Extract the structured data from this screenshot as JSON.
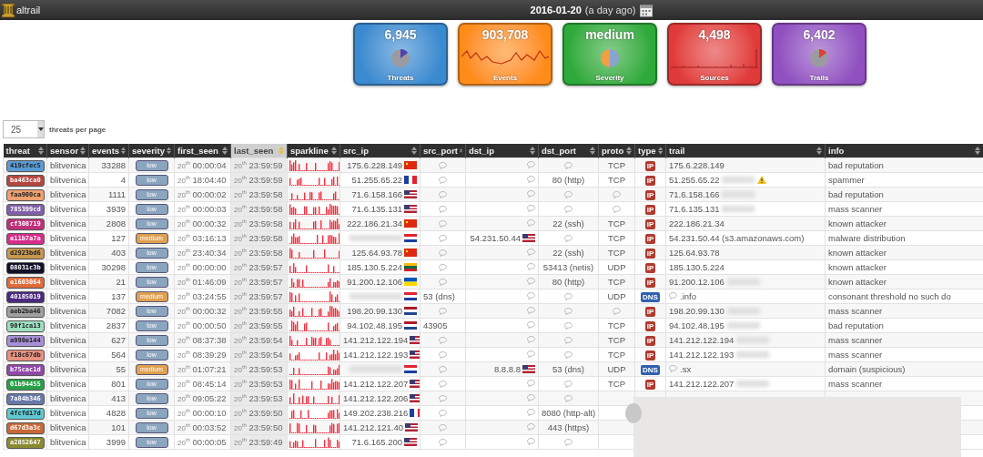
{
  "header": {
    "logo_text": "altrail",
    "date": "2016-01-20",
    "date_note": "(a day ago)"
  },
  "cards": [
    {
      "value": "6,945",
      "label": "Threats",
      "color": "#3a8ad0",
      "kind": "pie"
    },
    {
      "value": "903,708",
      "label": "Events",
      "color": "#ff8c1a",
      "kind": "line"
    },
    {
      "value": "medium",
      "label": "Severity",
      "color": "#2eaa3a",
      "kind": "pie"
    },
    {
      "value": "4,498",
      "label": "Sources",
      "color": "#e03a3a",
      "kind": "bars"
    },
    {
      "value": "6,402",
      "label": "Trails",
      "color": "#9050c0",
      "kind": "pie"
    }
  ],
  "page_size": {
    "value": "25",
    "label": "threats per page"
  },
  "columns": [
    {
      "label": "threat",
      "sorted": false
    },
    {
      "label": "sensor",
      "sorted": false
    },
    {
      "label": "events",
      "sorted": false
    },
    {
      "label": "severity",
      "sorted": false
    },
    {
      "label": "first_seen",
      "sorted": false
    },
    {
      "label": "last_seen",
      "sorted": true
    },
    {
      "label": "sparkline",
      "sorted": false
    },
    {
      "label": "src_ip",
      "sorted": false
    },
    {
      "label": "src_port",
      "sorted": false
    },
    {
      "label": "dst_ip",
      "sorted": false
    },
    {
      "label": "dst_port",
      "sorted": false
    },
    {
      "label": "proto",
      "sorted": false
    },
    {
      "label": "type",
      "sorted": false
    },
    {
      "label": "trail",
      "sorted": false
    },
    {
      "label": "info",
      "sorted": false
    }
  ],
  "rows": [
    {
      "threat": {
        "text": "419cfec5",
        "color": "#5b9bd5"
      },
      "sensor": "blitvenica",
      "events": "33288",
      "severity": {
        "text": "low",
        "color": "#8ba5bf"
      },
      "first_day": "20$^{th}$",
      "first_seen": "00:00:04",
      "last_day": "20$^{th}$",
      "last_seen": "23:59:59",
      "src_ip": "175.6.228.149",
      "src_flag": {
        "kind": "cn"
      },
      "src_port": null,
      "dst_ip": null,
      "dst_port": null,
      "proto": "TCP",
      "type": {
        "text": "IP",
        "color": "#b03a2e"
      },
      "trail": "175.6.228.149",
      "trail_note": false,
      "warning": false,
      "info": "bad reputation"
    },
    {
      "threat": {
        "text": "ba463ca0",
        "color": "#b5463e"
      },
      "sensor": "blitvenica",
      "events": "4",
      "severity": {
        "text": "low",
        "color": "#8ba5bf"
      },
      "first_day": "20$^{th}$",
      "first_seen": "18:04:40",
      "last_day": "20$^{th}$",
      "last_seen": "23:59:59",
      "src_ip": "51.255.65.22",
      "src_flag": {
        "kind": "fr"
      },
      "src_port": null,
      "dst_ip": null,
      "dst_port": "80 (http)",
      "proto": "TCP",
      "type": {
        "text": "IP",
        "color": "#b03a2e"
      },
      "trail": "51.255.65.22",
      "trail_note": true,
      "warning": true,
      "info": "spammer"
    },
    {
      "threat": {
        "text": "faa900ca",
        "color": "#f0a070"
      },
      "sensor": "blitvenica",
      "events": "1111",
      "severity": {
        "text": "low",
        "color": "#8ba5bf"
      },
      "first_day": "20$^{th}$",
      "first_seen": "00:00:02",
      "last_day": "20$^{th}$",
      "last_seen": "23:59:58",
      "src_ip": "71.6.158.166",
      "src_flag": {
        "kind": "us"
      },
      "src_port": null,
      "dst_ip": null,
      "dst_port": null,
      "proto": null,
      "type": {
        "text": "IP",
        "color": "#b03a2e"
      },
      "trail": "71.6.158.166",
      "trail_note": true,
      "warning": false,
      "info": "bad reputation"
    },
    {
      "threat": {
        "text": "785399cd",
        "color": "#8060a8"
      },
      "sensor": "blitvenica",
      "events": "3939",
      "severity": {
        "text": "low",
        "color": "#8ba5bf"
      },
      "first_day": "20$^{th}$",
      "first_seen": "00:00:03",
      "last_day": "20$^{th}$",
      "last_seen": "23:59:58",
      "src_ip": "71.6.135.131",
      "src_flag": {
        "kind": "us"
      },
      "src_port": null,
      "dst_ip": null,
      "dst_port": null,
      "proto": null,
      "type": {
        "text": "IP",
        "color": "#b03a2e"
      },
      "trail": "71.6.135.131",
      "trail_note": true,
      "warning": false,
      "info": "mass scanner"
    },
    {
      "threat": {
        "text": "cf308719",
        "color": "#c0307a"
      },
      "sensor": "blitvenica",
      "events": "2808",
      "severity": {
        "text": "low",
        "color": "#8ba5bf"
      },
      "first_day": "20$^{th}$",
      "first_seen": "00:00:32",
      "last_day": "20$^{th}$",
      "last_seen": "23:59:58",
      "src_ip": "222.186.21.34",
      "src_flag": {
        "kind": "cn"
      },
      "src_port": null,
      "dst_ip": null,
      "dst_port": "22 (ssh)",
      "proto": "TCP",
      "type": {
        "text": "IP",
        "color": "#b03a2e"
      },
      "trail": "222.186.21.34",
      "trail_note": false,
      "warning": false,
      "info": "known attacker"
    },
    {
      "threat": {
        "text": "e11b7a7a",
        "color": "#d82c8a"
      },
      "sensor": "blitvenica",
      "events": "127",
      "severity": {
        "text": "medium",
        "color": "#e0a050"
      },
      "first_day": "20$^{th}$",
      "first_seen": "03:16:13",
      "last_day": "20$^{th}$",
      "last_seen": "23:59:58",
      "src_redacted": true,
      "src_flag": {
        "kind": "hr"
      },
      "src_port": null,
      "dst_ip": "54.231.50.44",
      "dst_flag": {
        "kind": "us"
      },
      "dst_port": null,
      "proto": "TCP",
      "type": {
        "text": "IP",
        "color": "#b03a2e"
      },
      "trail": "54.231.50.44 (s3.amazonaws.com)",
      "trail_note": false,
      "warning": false,
      "info": "malware distribution"
    },
    {
      "threat": {
        "text": "d2923bd6",
        "color": "#c8984e"
      },
      "sensor": "blitvenica",
      "events": "403",
      "severity": {
        "text": "low",
        "color": "#8ba5bf"
      },
      "first_day": "20$^{th}$",
      "first_seen": "23:40:34",
      "last_day": "20$^{th}$",
      "last_seen": "23:59:58",
      "src_ip": "125.64.93.78",
      "src_flag": {
        "kind": "cn"
      },
      "src_port": null,
      "dst_ip": null,
      "dst_port": "22 (ssh)",
      "proto": "TCP",
      "type": {
        "text": "IP",
        "color": "#b03a2e"
      },
      "trail": "125.64.93.78",
      "trail_note": false,
      "warning": false,
      "info": "known attacker"
    },
    {
      "threat": {
        "text": "08031c3b",
        "color": "#101028"
      },
      "sensor": "blitvenica",
      "events": "30298",
      "severity": {
        "text": "low",
        "color": "#8ba5bf"
      },
      "first_day": "20$^{th}$",
      "first_seen": "00:00:00",
      "last_day": "20$^{th}$",
      "last_seen": "23:59:57",
      "src_ip": "185.130.5.224",
      "src_flag": {
        "kind": "lt"
      },
      "src_port": null,
      "dst_ip": null,
      "dst_port": "53413 (netis)",
      "proto": "UDP",
      "type": {
        "text": "IP",
        "color": "#b03a2e"
      },
      "trail": "185.130.5.224",
      "trail_note": false,
      "warning": false,
      "info": "known attacker"
    },
    {
      "threat": {
        "text": "e1603064",
        "color": "#e06a3a"
      },
      "sensor": "blitvenica",
      "events": "21",
      "severity": {
        "text": "low",
        "color": "#8ba5bf"
      },
      "first_day": "20$^{th}$",
      "first_seen": "01:46:09",
      "last_day": "20$^{th}$",
      "last_seen": "23:59:57",
      "src_ip": "91.200.12.106",
      "src_flag": {
        "kind": "ua"
      },
      "src_port": null,
      "dst_ip": null,
      "dst_port": "80 (http)",
      "proto": "TCP",
      "type": {
        "text": "IP",
        "color": "#b03a2e"
      },
      "trail": "91.200.12.106",
      "trail_note": true,
      "warning": false,
      "info": "known attacker"
    },
    {
      "threat": {
        "text": "40185019",
        "color": "#4a2a80"
      },
      "sensor": "blitvenica",
      "events": "137",
      "severity": {
        "text": "medium",
        "color": "#e0a050"
      },
      "first_day": "20$^{th}$",
      "first_seen": "03:24:55",
      "last_day": "20$^{th}$",
      "last_seen": "23:59:57",
      "src_redacted": true,
      "src_flag": {
        "kind": "hr"
      },
      "src_port": "53 (dns)",
      "dst_ip": null,
      "dst_port": null,
      "proto": "UDP",
      "type": {
        "text": "DNS",
        "color": "#3060b0"
      },
      "trail": ".info",
      "trail_bubble": true,
      "trail_note": false,
      "warning": false,
      "info": "consonant threshold no such do"
    },
    {
      "threat": {
        "text": "aeb2ba46",
        "color": "#a0a0a0"
      },
      "sensor": "blitvenica",
      "events": "7082",
      "severity": {
        "text": "low",
        "color": "#8ba5bf"
      },
      "first_day": "20$^{th}$",
      "first_seen": "00:00:32",
      "last_day": "20$^{th}$",
      "last_seen": "23:59:55",
      "src_ip": "198.20.99.130",
      "src_flag": {
        "kind": "nl"
      },
      "src_port": null,
      "dst_ip": null,
      "dst_port": null,
      "proto": null,
      "type": {
        "text": "IP",
        "color": "#b03a2e"
      },
      "trail": "198.20.99.130",
      "trail_note": true,
      "warning": false,
      "info": "mass scanner"
    },
    {
      "threat": {
        "text": "90f1ca13",
        "color": "#9de0c0"
      },
      "sensor": "blitvenica",
      "events": "2837",
      "severity": {
        "text": "low",
        "color": "#8ba5bf"
      },
      "first_day": "20$^{th}$",
      "first_seen": "00:00:50",
      "last_day": "20$^{th}$",
      "last_seen": "23:59:55",
      "src_ip": "94.102.48.195",
      "src_flag": {
        "kind": "nl"
      },
      "src_port": "43905",
      "dst_ip": null,
      "dst_port": null,
      "proto": "TCP",
      "type": {
        "text": "IP",
        "color": "#b03a2e"
      },
      "trail": "94.102.48.195",
      "trail_note": true,
      "warning": false,
      "info": "bad reputation"
    },
    {
      "threat": {
        "text": "a990e144",
        "color": "#a890d8"
      },
      "sensor": "blitvenica",
      "events": "627",
      "severity": {
        "text": "low",
        "color": "#8ba5bf"
      },
      "first_day": "20$^{th}$",
      "first_seen": "08:37:38",
      "last_day": "20$^{th}$",
      "last_seen": "23:59:54",
      "src_ip": "141.212.122.194",
      "src_flag": {
        "kind": "us"
      },
      "src_port": null,
      "dst_ip": null,
      "dst_port": null,
      "proto": "TCP",
      "type": {
        "text": "IP",
        "color": "#b03a2e"
      },
      "trail": "141.212.122.194",
      "trail_note": true,
      "warning": false,
      "info": "mass scanner"
    },
    {
      "threat": {
        "text": "f18c67db",
        "color": "#e89080"
      },
      "sensor": "blitvenica",
      "events": "564",
      "severity": {
        "text": "low",
        "color": "#8ba5bf"
      },
      "first_day": "20$^{th}$",
      "first_seen": "08:39:29",
      "last_day": "20$^{th}$",
      "last_seen": "23:59:54",
      "src_ip": "141.212.122.193",
      "src_flag": {
        "kind": "us"
      },
      "src_port": null,
      "dst_ip": null,
      "dst_port": null,
      "proto": "TCP",
      "type": {
        "text": "IP",
        "color": "#b03a2e"
      },
      "trail": "141.212.122.193",
      "trail_note": true,
      "warning": false,
      "info": "mass scanner"
    },
    {
      "threat": {
        "text": "b75cac1d",
        "color": "#9048a8"
      },
      "sensor": "blitvenica",
      "events": "55",
      "severity": {
        "text": "medium",
        "color": "#e0a050"
      },
      "first_day": "20$^{th}$",
      "first_seen": "01:07:21",
      "last_day": "20$^{th}$",
      "last_seen": "23:59:53",
      "src_redacted": true,
      "src_flag": {
        "kind": "hr"
      },
      "src_port": null,
      "dst_ip": "8.8.8.8",
      "dst_flag": {
        "kind": "us"
      },
      "dst_port": "53 (dns)",
      "proto": "UDP",
      "type": {
        "text": "DNS",
        "color": "#3060b0"
      },
      "trail": ".sx",
      "trail_bubble": true,
      "trail_note": false,
      "warning": false,
      "info": "domain (suspicious)"
    },
    {
      "threat": {
        "text": "01b94455",
        "color": "#28a048"
      },
      "sensor": "blitvenica",
      "events": "801",
      "severity": {
        "text": "low",
        "color": "#8ba5bf"
      },
      "first_day": "20$^{th}$",
      "first_seen": "08:45:14",
      "last_day": "20$^{th}$",
      "last_seen": "23:59:53",
      "src_ip": "141.212.122.207",
      "src_flag": {
        "kind": "us"
      },
      "src_port": null,
      "dst_ip": null,
      "dst_port": null,
      "proto": "TCP",
      "type": {
        "text": "IP",
        "color": "#b03a2e"
      },
      "trail": "141.212.122.207",
      "trail_note": true,
      "warning": false,
      "info": "mass scanner"
    },
    {
      "threat": {
        "text": "7a84b346",
        "color": "#6878a8"
      },
      "sensor": "blitvenica",
      "events": "413",
      "severity": {
        "text": "low",
        "color": "#8ba5bf"
      },
      "first_day": "20$^{th}$",
      "first_seen": "09:05:22",
      "last_day": "20$^{th}$",
      "last_seen": "23:59:53",
      "src_ip": "141.212.122.206",
      "src_flag": {
        "kind": "us"
      },
      "src_port": null,
      "dst_ip": null,
      "dst_port": null
    },
    {
      "threat": {
        "text": "4fcfd17d",
        "color": "#60c8d0"
      },
      "sensor": "blitvenica",
      "events": "4828",
      "severity": {
        "text": "low",
        "color": "#8ba5bf"
      },
      "first_day": "20$^{th}$",
      "first_seen": "00:00:10",
      "last_day": "20$^{th}$",
      "last_seen": "23:59:50",
      "src_ip": "149.202.238.216",
      "src_flag": {
        "kind": "fr"
      },
      "src_port": null,
      "dst_ip": null,
      "dst_port": "8080 (http-alt)"
    },
    {
      "threat": {
        "text": "d67d3a3c",
        "color": "#c86838"
      },
      "sensor": "blitvenica",
      "events": "101",
      "severity": {
        "text": "low",
        "color": "#8ba5bf"
      },
      "first_day": "20$^{th}$",
      "first_seen": "00:03:52",
      "last_day": "20$^{th}$",
      "last_seen": "23:59:50",
      "src_ip": "141.212.121.40",
      "src_flag": {
        "kind": "us"
      },
      "src_port": null,
      "dst_ip": null,
      "dst_port": "443 (https)"
    },
    {
      "threat": {
        "text": "a2852647",
        "color": "#8a8a30"
      },
      "sensor": "blitvenica",
      "events": "3999",
      "severity": {
        "text": "low",
        "color": "#8ba5bf"
      },
      "first_day": "20$^{th}$",
      "first_seen": "00:00:05",
      "last_day": "20$^{th}$",
      "last_seen": "23:59:49",
      "src_ip": "71.6.165.200",
      "src_flag": {
        "kind": "us"
      },
      "src_port": null,
      "dst_ip": null,
      "dst_port": null
    }
  ]
}
